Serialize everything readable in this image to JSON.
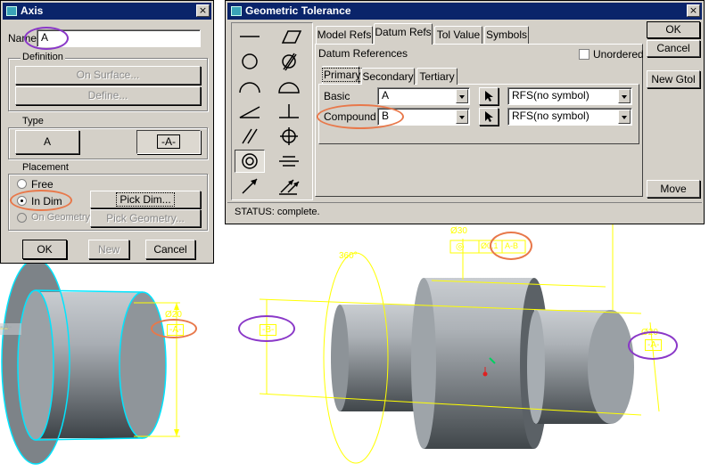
{
  "axis_dialog": {
    "title": "Axis",
    "close_label": "×",
    "name_label": "Name",
    "name_value": "A",
    "definition": {
      "label": "Definition",
      "on_surface_label": "On Surface...",
      "define_label": "Define..."
    },
    "type": {
      "label": "Type",
      "option_a_label": "A",
      "option_boxed_label": "-A-"
    },
    "placement": {
      "label": "Placement",
      "free_label": "Free",
      "in_dim_label": "In Dim",
      "on_geometry_label": "On Geometry",
      "pick_dim_label": "Pick Dim...",
      "pick_geometry_label": "Pick Geometry...",
      "selected": "In Dim"
    },
    "ok_label": "OK",
    "new_label": "New",
    "cancel_label": "Cancel"
  },
  "gtol_dialog": {
    "title": "Geometric Tolerance",
    "close_label": "×",
    "symbols": [
      "straightness",
      "flatness",
      "circularity",
      "cylindricity",
      "profile-line",
      "profile-surface",
      "angularity",
      "perpendicularity",
      "parallelism",
      "position",
      "concentricity",
      "symmetry",
      "circular-runout",
      "total-runout"
    ],
    "selected_symbol": "concentricity",
    "tabs": [
      "Model Refs",
      "Datum Refs",
      "Tol Value",
      "Symbols"
    ],
    "active_tab": "Datum Refs",
    "datum_references_label": "Datum References",
    "unordered_label": "Unordered",
    "subtabs": [
      "Primary",
      "Secondary",
      "Tertiary"
    ],
    "active_subtab": "Primary",
    "basic_label": "Basic",
    "basic_value": "A",
    "compound_label": "Compound",
    "compound_value": "B",
    "material_basic": "RFS(no symbol)",
    "material_compound": "RFS(no symbol)",
    "ok_label": "OK",
    "cancel_label": "Cancel",
    "new_gtol_label": "New Gtol",
    "move_label": "Move",
    "status": "STATUS: complete."
  },
  "left_viewport": {
    "dim_label": "Ø20",
    "datum_label": "-A-",
    "edge_label": "-A-"
  },
  "right_viewport": {
    "dim_top": "Ø30",
    "dim_angle": "360°",
    "gtol_tol": "Ø0.1",
    "gtol_datum": "A-B",
    "datum_b": "-B-",
    "datum_a": "-A-",
    "dim_right": "Ø20"
  },
  "colors": {
    "title_bar": "#0a246a",
    "dialog_bg": "#d4d0c8",
    "annotation_orange": "#e8784a",
    "annotation_purple": "#8a38c8",
    "cad_yellow": "#ffff00",
    "cad_cyan": "#00e5ff"
  }
}
